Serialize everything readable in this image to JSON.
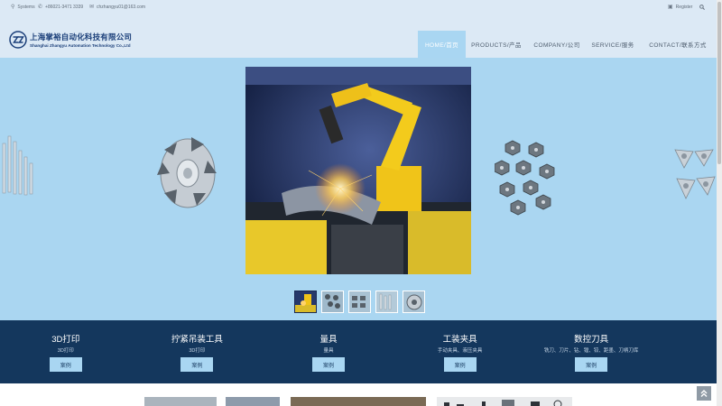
{
  "topbar": {
    "location": "Systems",
    "phone": "+86021-3471 3339",
    "email": "chzhangyu01@163.com",
    "register": "Register",
    "icons": {
      "location": "map-pin-icon",
      "phone": "phone-icon",
      "email": "mail-icon",
      "lock": "lock-icon",
      "search": "search-icon"
    }
  },
  "logo": {
    "cn": "上海掌裕自动化科技有限公司",
    "en": "Shanghai Zhangyu Automation Technology Co.,Ltd"
  },
  "nav": [
    {
      "label": "HOME/首页"
    },
    {
      "label": "PRODUCTS/产品"
    },
    {
      "label": "COMPANY/公司"
    },
    {
      "label": "SERVICE/服务"
    },
    {
      "label": "CONTACT/联系方式"
    }
  ],
  "banner": {
    "active_thumb": 1,
    "thumb_count": 5
  },
  "categories": [
    {
      "title": "3D打印",
      "sub": "3D打印",
      "button": "案例"
    },
    {
      "title": "拧紧吊装工具",
      "sub": "3D打印",
      "button": "案例"
    },
    {
      "title": "量具",
      "sub": "量具",
      "button": "案例"
    },
    {
      "title": "工装夹具",
      "sub": "手动夹具、液压夹具",
      "button": "案例"
    },
    {
      "title": "数控刀具",
      "sub": "铣刀、刀片、钻、镗、铰、距墨、刀柄刀库",
      "button": "案例"
    }
  ],
  "colors": {
    "accent": "#a9d6f2",
    "banner": "#aad6f1",
    "navy": "#14375d",
    "header": "#dce9f5"
  }
}
